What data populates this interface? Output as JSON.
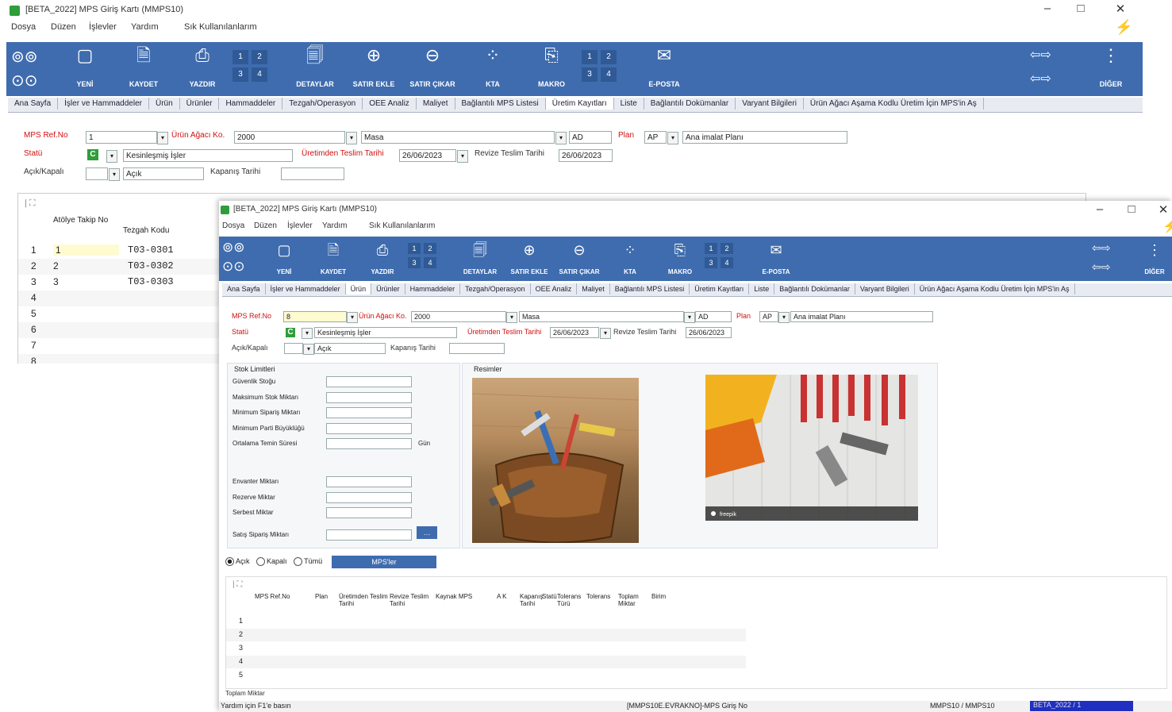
{
  "win1": {
    "title": "[BETA_2022] MPS Giriş Kartı (MMPS10)",
    "menu": [
      "Dosya",
      "Düzen",
      "İşlevler",
      "Yardım",
      "Sık Kullanılanlarım"
    ],
    "toolbar": {
      "new": "YENİ",
      "save": "KAYDET",
      "print": "YAZDIR",
      "details": "DETAYLAR",
      "add_row": "SATIR EKLE",
      "remove_row": "SATIR ÇIKAR",
      "kta": "KTA",
      "macro": "MAKRO",
      "email": "E-POSTA",
      "other": "DİĞER"
    },
    "numgrid": [
      "1",
      "2",
      "3",
      "4"
    ],
    "tabs": [
      "Ana Sayfa",
      "İşler ve Hammaddeler",
      "Ürün",
      "Ürünler",
      "Hammaddeler",
      "Tezgah/Operasyon",
      "OEE Analiz",
      "Maliyet",
      "Bağlantılı MPS Listesi",
      "Üretim Kayıtları",
      "Liste",
      "Bağlantılı Dokümanlar",
      "Varyant Bilgileri",
      "Ürün Ağacı Aşama Kodlu Üretim İçin MPS'in Aş"
    ],
    "active_tab": "Üretim Kayıtları",
    "form": {
      "mps_ref_label": "MPS Ref.No",
      "mps_ref_value": "1",
      "urun_agaci_label": "Ürün Ağacı Ko.",
      "urun_agaci_value": "2000",
      "urun_agaci_name": "Masa",
      "ad_value": "AD",
      "plan_label": "Plan",
      "plan_value": "AP",
      "plan_name": "Ana imalat Planı",
      "statu_label": "Statü",
      "statu_code": "C",
      "statu_value": "Kesinleşmiş İşler",
      "uretimden_label": "Üretimden Teslim Tarihi",
      "uretimden_value": "26/06/2023",
      "revize_label": "Revize Teslim Tarihi",
      "revize_value": "26/06/2023",
      "acik_label": "Açık/Kapalı",
      "acik_value": "Açık",
      "kapanis_label": "Kapanış Tarihi"
    },
    "grid": {
      "headers": [
        "Atölye Takip No",
        "Tezgah Kodu"
      ],
      "rows": [
        {
          "n": "1",
          "takip": "1",
          "kod": "T03-0301"
        },
        {
          "n": "2",
          "takip": "2",
          "kod": "T03-0302"
        },
        {
          "n": "3",
          "takip": "3",
          "kod": "T03-0303"
        },
        {
          "n": "4",
          "takip": "",
          "kod": ""
        },
        {
          "n": "5",
          "takip": "",
          "kod": ""
        },
        {
          "n": "6",
          "takip": "",
          "kod": ""
        },
        {
          "n": "7",
          "takip": "",
          "kod": ""
        },
        {
          "n": "8",
          "takip": "",
          "kod": ""
        }
      ]
    }
  },
  "win2": {
    "title": "[BETA_2022] MPS Giriş Kartı (MMPS10)",
    "menu": [
      "Dosya",
      "Düzen",
      "İşlevler",
      "Yardım",
      "Sık Kullanılanlarım"
    ],
    "toolbar": {
      "new": "YENİ",
      "save": "KAYDET",
      "print": "YAZDIR",
      "details": "DETAYLAR",
      "add_row": "SATIR EKLE",
      "remove_row": "SATIR ÇIKAR",
      "kta": "KTA",
      "macro": "MAKRO",
      "email": "E-POSTA",
      "other": "DİĞER"
    },
    "numgrid": [
      "1",
      "2",
      "3",
      "4"
    ],
    "tabs": [
      "Ana Sayfa",
      "İşler ve Hammaddeler",
      "Ürün",
      "Ürünler",
      "Hammaddeler",
      "Tezgah/Operasyon",
      "OEE Analiz",
      "Maliyet",
      "Bağlantılı MPS Listesi",
      "Üretim Kayıtları",
      "Liste",
      "Bağlantılı Dokümanlar",
      "Varyant Bilgileri",
      "Ürün Ağacı Aşama Kodlu Üretim İçin MPS'in Aş"
    ],
    "active_tab": "Ürün",
    "form": {
      "mps_ref_label": "MPS Ref.No",
      "mps_ref_value": "8",
      "urun_agaci_label": "Ürün Ağacı Ko.",
      "urun_agaci_value": "2000",
      "urun_agaci_name": "Masa",
      "ad_value": "AD",
      "plan_label": "Plan",
      "plan_value": "AP",
      "plan_name": "Ana imalat Planı",
      "statu_label": "Statü",
      "statu_code": "C",
      "statu_value": "Kesinleşmiş İşler",
      "uretimden_label": "Üretimden Teslim Tarihi",
      "uretimden_value": "26/06/2023",
      "revize_label": "Revize Teslim Tarihi",
      "revize_value": "26/06/2023",
      "acik_label": "Açık/Kapalı",
      "acik_value": "Açık",
      "kapanis_label": "Kapanış Tarihi"
    },
    "stok": {
      "title": "Stok Limitleri",
      "rows": [
        "Güvenlik Stoğu",
        "Maksimum Stok Miktarı",
        "Minimum Sipariş Miktarı",
        "Minimum Parti Büyüklüğü",
        "Ortalama Temin Süresi"
      ],
      "unit": "Gün",
      "rows2": [
        "Envanter Miktarı",
        "Rezerve Miktar",
        "Serbest Miktar",
        "Satış Sipariş Miktarı"
      ]
    },
    "resimler_title": "Resimler",
    "photo_watermark": "freepik",
    "radios": {
      "acik": "Açık",
      "kapali": "Kapalı",
      "tumu": "Tümü",
      "button": "MPS'ler"
    },
    "grid": {
      "headers": [
        "MPS Ref.No",
        "Plan",
        "Üretimden Teslim Tarihi",
        "Revize Teslim Tarihi",
        "Kaynak MPS",
        "A K",
        "Kapanış Tarihi",
        "Statü",
        "Tolerans Türü",
        "Tolerans",
        "Toplam Miktar",
        "Birim"
      ],
      "rows": [
        "1",
        "2",
        "3",
        "4",
        "5"
      ]
    },
    "footer_label": "Toplam Miktar",
    "status": {
      "help": "Yardım için F1'e basın",
      "doc": "[MMPS10E.EVRAKNO]-MPS Giriş No",
      "form": "MMPS10 / MMPS10",
      "company": "BETA_2022 / 1"
    }
  }
}
